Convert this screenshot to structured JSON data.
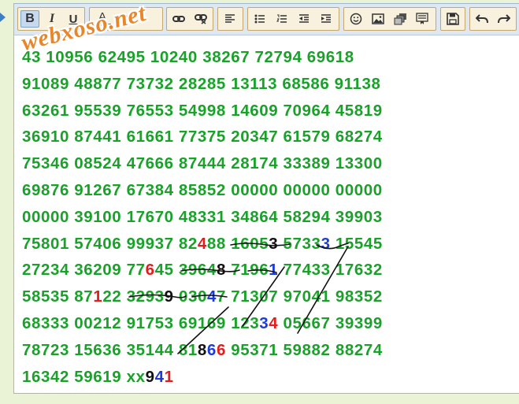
{
  "toolbar": {
    "groups": [
      {
        "name": "text-style",
        "buttons": [
          {
            "icon": "bold-icon",
            "label": "B",
            "active": true
          },
          {
            "icon": "italic-icon",
            "label": "I"
          },
          {
            "icon": "underline-icon",
            "label": "U"
          }
        ]
      },
      {
        "name": "color",
        "buttons": [
          {
            "icon": "font-color-icon",
            "label": "A"
          },
          {
            "icon": "background-color-icon",
            "label": "A"
          }
        ]
      },
      {
        "name": "link",
        "buttons": [
          {
            "icon": "link-icon"
          },
          {
            "icon": "unlink-icon"
          }
        ]
      },
      {
        "name": "align",
        "buttons": [
          {
            "icon": "align-left-icon"
          }
        ]
      },
      {
        "name": "lists",
        "buttons": [
          {
            "icon": "bullet-list-icon"
          },
          {
            "icon": "numbered-list-icon"
          },
          {
            "icon": "outdent-icon"
          },
          {
            "icon": "indent-icon"
          }
        ]
      },
      {
        "name": "insert",
        "buttons": [
          {
            "icon": "smiley-icon"
          },
          {
            "icon": "image-icon"
          },
          {
            "icon": "gallery-icon"
          },
          {
            "icon": "template-icon"
          }
        ]
      },
      {
        "name": "save",
        "buttons": [
          {
            "icon": "save-icon"
          }
        ]
      },
      {
        "name": "history",
        "buttons": [
          {
            "icon": "undo-icon"
          },
          {
            "icon": "redo-icon"
          }
        ]
      }
    ]
  },
  "watermark": "webxoso.net",
  "lines": [
    [
      {
        "t": "43 10956 62495 10240 38267 72794 69618",
        "c": "g"
      }
    ],
    [
      {
        "t": "91089 48877 73732 28285 13113 68586 91138",
        "c": "g"
      }
    ],
    [
      {
        "t": "63261 95539 76553 54998 14609 70964 45819",
        "c": "g"
      }
    ],
    [
      {
        "t": "36910 87441 61661 77375 20347 61579 68274",
        "c": "g"
      }
    ],
    [
      {
        "t": "75346 08524 47666 87444 28174 33389 13300",
        "c": "g"
      }
    ],
    [
      {
        "t": "69876 91267 67384 85852 00000 00000 00000",
        "c": "g"
      }
    ],
    [
      {
        "t": "00000 39100 17670 48331 34864 58294 39903",
        "c": "g"
      }
    ],
    [
      {
        "t": "75801 57406 99937 82",
        "c": "g"
      },
      {
        "t": "4",
        "c": "r"
      },
      {
        "t": "88 1605",
        "c": "g"
      },
      {
        "t": "3",
        "c": "k"
      },
      {
        "t": " 5733",
        "c": "g"
      },
      {
        "t": "3",
        "c": "b"
      },
      {
        "t": " 15545",
        "c": "g"
      }
    ],
    [
      {
        "t": "27234 36209 77",
        "c": "g"
      },
      {
        "t": "6",
        "c": "r"
      },
      {
        "t": "45 3964",
        "c": "g"
      },
      {
        "t": "8",
        "c": "k"
      },
      {
        "t": " 7196",
        "c": "g"
      },
      {
        "t": "1",
        "c": "b"
      },
      {
        "t": " 77433 17632",
        "c": "g"
      }
    ],
    [
      {
        "t": "58535 87",
        "c": "g"
      },
      {
        "t": "1",
        "c": "r"
      },
      {
        "t": "22 3293",
        "c": "g"
      },
      {
        "t": "9",
        "c": "k"
      },
      {
        "t": " 030",
        "c": "g"
      },
      {
        "t": "4",
        "c": "b"
      },
      {
        "t": "7 71307 97041 98352",
        "c": "g"
      }
    ],
    [
      {
        "t": "68333 00212 91753 69169 123",
        "c": "g"
      },
      {
        "t": "3",
        "c": "b"
      },
      {
        "t": "4",
        "c": "r"
      },
      {
        "t": " 05667 39399",
        "c": "g"
      }
    ],
    [
      {
        "t": "78723 15636 35144 81",
        "c": "g"
      },
      {
        "t": "8",
        "c": "k"
      },
      {
        "t": "6",
        "c": "b"
      },
      {
        "t": "6",
        "c": "r"
      },
      {
        "t": " 95371 59882 88274",
        "c": "g"
      }
    ],
    [
      {
        "t": "16342 59619 xx",
        "c": "g"
      },
      {
        "t": "9",
        "c": "k"
      },
      {
        "t": "4",
        "c": "b"
      },
      {
        "t": "1",
        "c": "r"
      }
    ]
  ]
}
